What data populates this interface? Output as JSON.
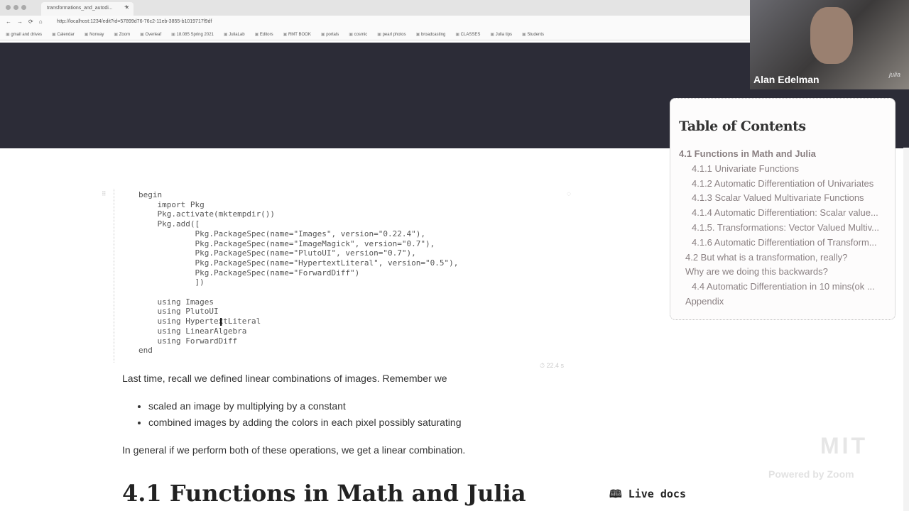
{
  "browser": {
    "tab_title": "transformations_and_autodi...",
    "url": "http://localhost:1234/edit?id=57899d76-76c2-11eb-3855-b1019717f9df",
    "bookmarks": [
      "gmail and drives",
      "Calendar",
      "Norway",
      "Zoom",
      "Overleaf",
      "18.085 Spring 2021",
      "JuliaLab",
      "Editors",
      "RMT BOOK",
      "portals",
      "cosmic",
      "pearl photos",
      "broadcasting",
      "CLASSES",
      "Julia tips",
      "Students"
    ]
  },
  "webcam": {
    "name": "Alan Edelman",
    "logo": "julia"
  },
  "toc": {
    "title": "Table of Contents",
    "items": [
      {
        "label": "4.1 Functions in Math and Julia",
        "level": 1
      },
      {
        "label": "4.1.1 Univariate Functions",
        "level": 2
      },
      {
        "label": "4.1.2 Automatic Differentiation of Univariates",
        "level": 2
      },
      {
        "label": "4.1.3 Scalar Valued Multivariate Functions",
        "level": 2
      },
      {
        "label": "4.1.4 Automatic Differentiation: Scalar value...",
        "level": 2
      },
      {
        "label": "4.1.5. Transformations: Vector Valued Multiv...",
        "level": 2
      },
      {
        "label": "4.1.6 Automatic Differentiation of Transform...",
        "level": 2
      },
      {
        "label": "4.2 But what is a transformation, really?",
        "level": 3
      },
      {
        "label": "Why are we doing this backwards?",
        "level": 3
      },
      {
        "label": "4.4 Automatic Differentiation in 10 mins(ok ...",
        "level": 2
      },
      {
        "label": "Appendix",
        "level": 3
      }
    ]
  },
  "cell": {
    "code": "begin\n    import Pkg\n    Pkg.activate(mktempdir())\n    Pkg.add([\n            Pkg.PackageSpec(name=\"Images\", version=\"0.22.4\"),\n            Pkg.PackageSpec(name=\"ImageMagick\", version=\"0.7\"),\n            Pkg.PackageSpec(name=\"PlutoUI\", version=\"0.7\"),\n            Pkg.PackageSpec(name=\"HypertextLiteral\", version=\"0.5\"),\n            Pkg.PackageSpec(name=\"ForwardDiff\")\n            ])\n\n    using Images\n    using PlutoUI\n    using HypertextLiteral\n    using LinearAlgebra\n    using ForwardDiff\nend",
    "runtime": "22.4 s"
  },
  "text": {
    "p1": "Last time, recall we defined linear combinations of images. Remember we",
    "bullets": [
      "scaled an image by multiplying by a constant",
      "combined images by adding the colors in each pixel possibly saturating"
    ],
    "p2": "In general if we perform both of these operations, we get a linear combination.",
    "heading": "4.1 Functions in Math and Julia"
  },
  "live_docs": "Live docs",
  "watermarks": {
    "mit": "MIT",
    "zoom": "Powered by Zoom"
  }
}
